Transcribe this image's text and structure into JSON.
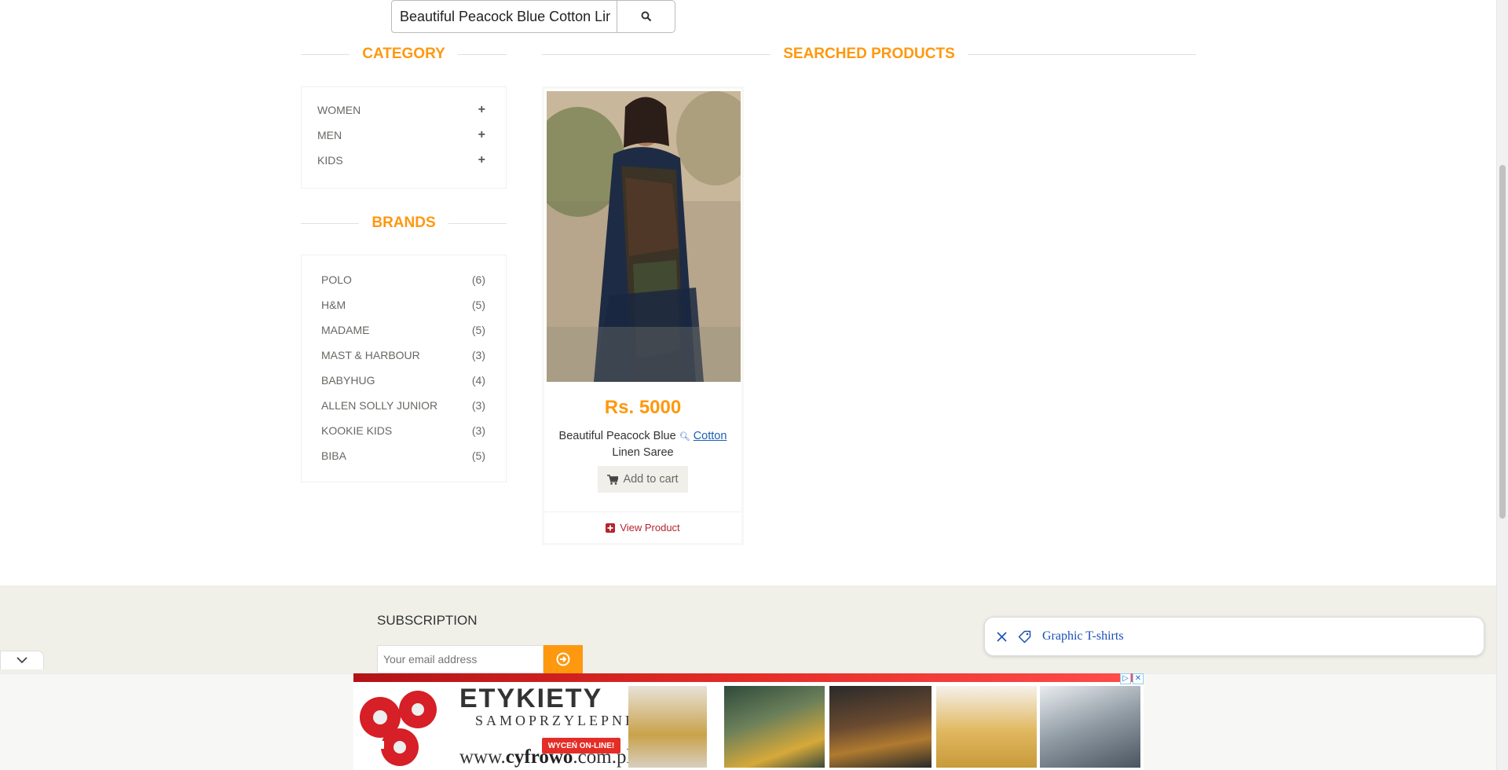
{
  "search": {
    "value": "Beautiful Peacock Blue Cotton Linen Saree",
    "button_icon": "search-icon"
  },
  "sidebar": {
    "category_title": "CATEGORY",
    "categories": [
      {
        "label": "WOMEN",
        "icon": "plus-icon"
      },
      {
        "label": "MEN",
        "icon": "plus-icon"
      },
      {
        "label": "KIDS",
        "icon": "plus-icon"
      }
    ],
    "brands_title": "BRANDS",
    "brands": [
      {
        "name": "POLO",
        "count": "(6)"
      },
      {
        "name": "H&M",
        "count": "(5)"
      },
      {
        "name": "MADAME",
        "count": "(5)"
      },
      {
        "name": "MAST & HARBOUR",
        "count": "(3)"
      },
      {
        "name": "BABYHUG",
        "count": "(4)"
      },
      {
        "name": "ALLEN SOLLY JUNIOR",
        "count": "(3)"
      },
      {
        "name": "KOOKIE KIDS",
        "count": "(3)"
      },
      {
        "name": "BIBA",
        "count": "(5)"
      }
    ]
  },
  "main": {
    "title": "SEARCHED PRODUCTS",
    "product": {
      "price": "Rs. 5000",
      "name_before": "Beautiful Peacock Blue",
      "name_link": "Cotton",
      "name_after": "Linen Saree",
      "add_to_cart": "Add to cart",
      "view_product": "View Product"
    }
  },
  "footer": {
    "subscription_title": "SUBSCRIPTION",
    "email_placeholder": "Your email address"
  },
  "suggestion_chip": {
    "label": "Graphic T-shirts"
  },
  "ad": {
    "headline": "ETYKIETY",
    "subline": "SAMOPRZYLEPNE",
    "badge": "WYCEŃ ON-LINE!",
    "url_prefix": "www.",
    "url_brand": "cyfrowo",
    "url_suffix": ".com.pl"
  },
  "colors": {
    "accent": "#fe980f",
    "link": "#1a5fb4",
    "footer_bg": "#f0f0e9",
    "view_product": "#b4242c"
  }
}
